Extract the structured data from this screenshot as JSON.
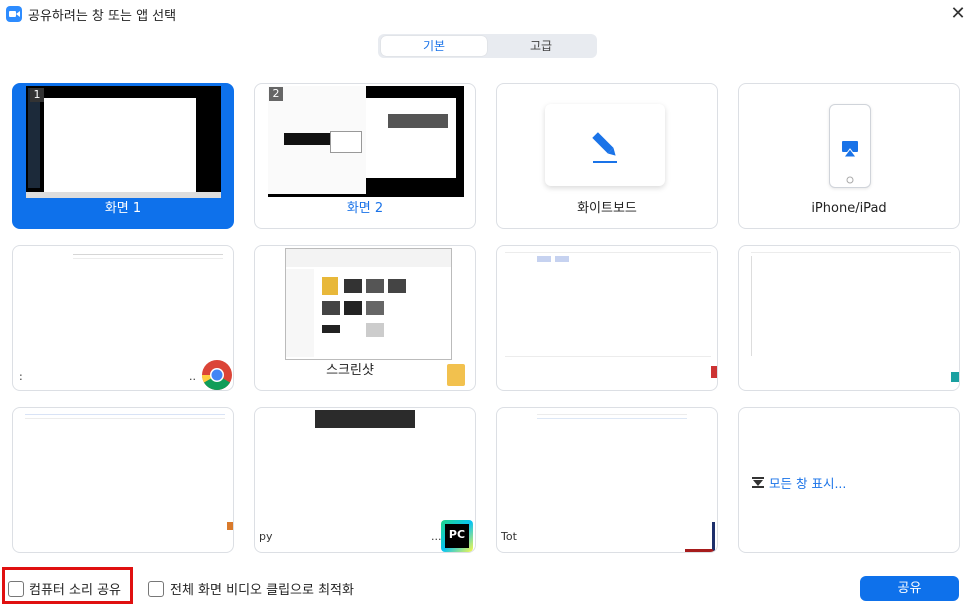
{
  "window": {
    "title": "공유하려는 창 또는 앱 선택",
    "close": "✕"
  },
  "tabs": {
    "basic": "기본",
    "advanced": "고급"
  },
  "tiles": {
    "screen1": {
      "label": "화면 1",
      "badge": "1"
    },
    "screen2": {
      "label": "화면 2",
      "badge": "2"
    },
    "whiteboard": {
      "label": "화이트보드"
    },
    "iphone": {
      "label": "iPhone/iPad"
    },
    "chrome": {
      "label": "..",
      "prefix": ":"
    },
    "screenshot": {
      "label": "스크린샷"
    },
    "window3": {
      "label": ""
    },
    "window4": {
      "label": ""
    },
    "window5": {
      "label": ""
    },
    "pycharm": {
      "label": "...",
      "prefix": "py",
      "icon_text": "PC"
    },
    "tot": {
      "label": "Tot"
    },
    "all_windows": {
      "label": "모든 창 표시..."
    }
  },
  "footer": {
    "computer_sound": "컴퓨터 소리 공유",
    "optimize_video": "전체 화면 비디오 클립으로 최적화",
    "share_button": "공유"
  },
  "colors": {
    "accent": "#0e71eb",
    "highlight": "#e01010"
  }
}
